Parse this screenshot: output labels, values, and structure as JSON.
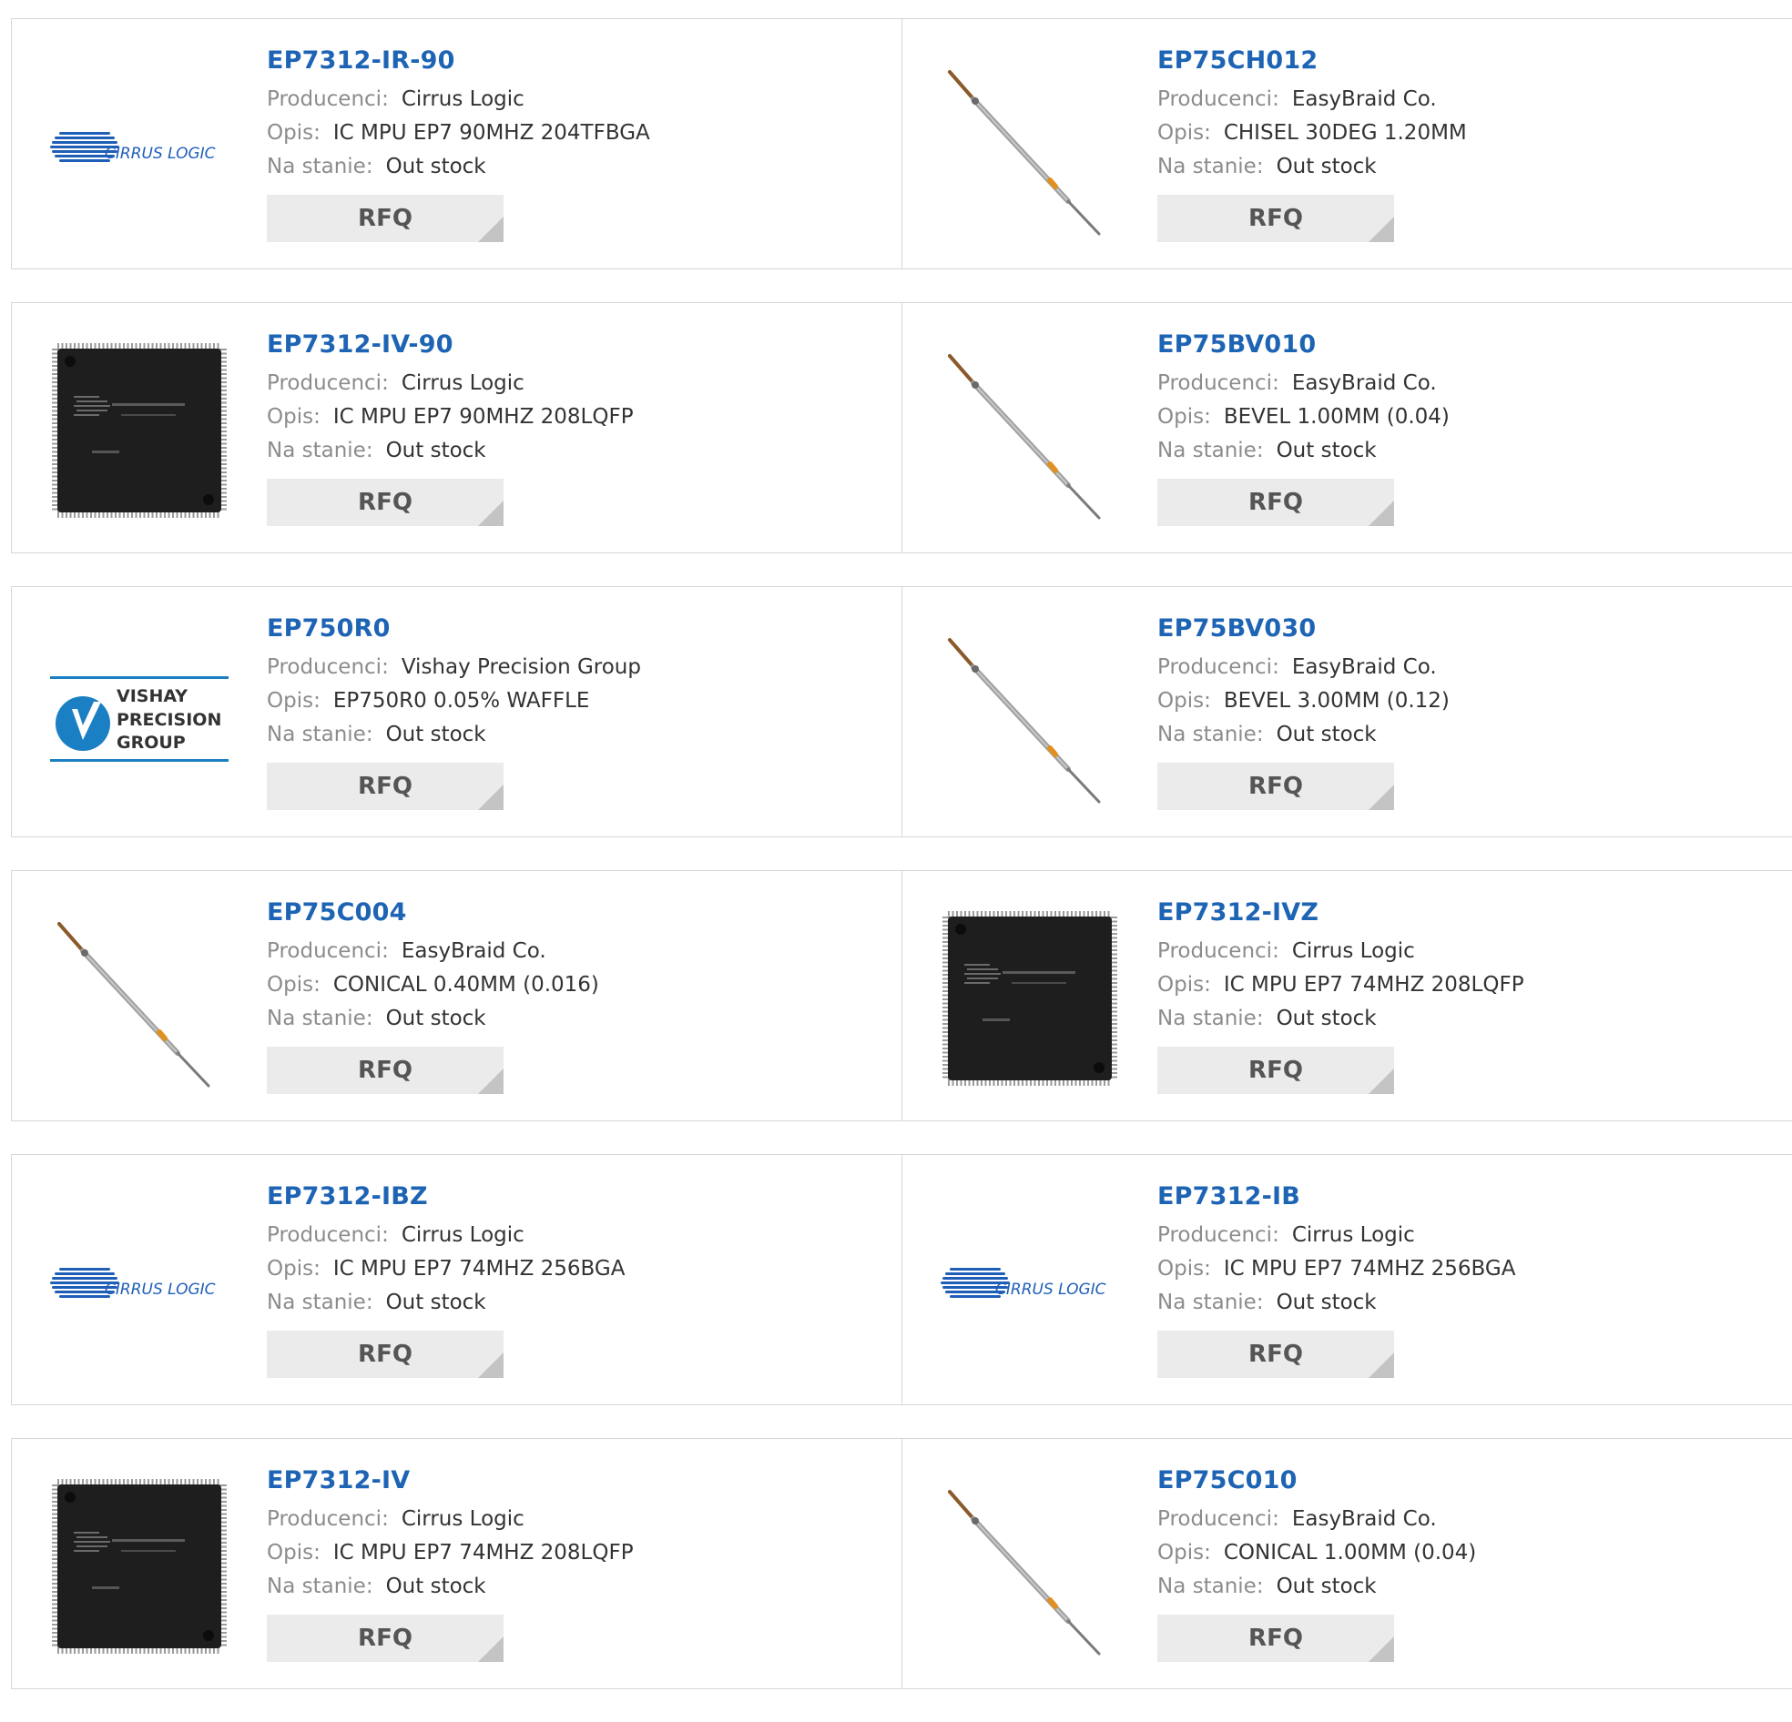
{
  "labels": {
    "manufacturer": "Producenci:",
    "description": "Opis:",
    "stock": "Na stanie:",
    "rfq": "RFQ"
  },
  "colors": {
    "part_link": "#1e64b4",
    "label_gray": "#8c8c8c",
    "button_bg": "#ebebeb",
    "button_corner": "#c4c4c4",
    "card_border": "#d6d6d6",
    "cirrus_blue": "#1f5fb8",
    "vishay_blue": "#1b7fc4"
  },
  "products": [
    {
      "part": "EP7312-IR-90",
      "manufacturer": "Cirrus Logic",
      "description": "IC MPU EP7 90MHZ 204TFBGA",
      "stock": "Out stock",
      "image": "cirrus-logo",
      "image_text": "CIRRUS LOGIC"
    },
    {
      "part": "EP75CH012",
      "manufacturer": "EasyBraid Co.",
      "description": "CHISEL 30DEG 1.20MM",
      "stock": "Out stock",
      "image": "solder-tip"
    },
    {
      "part": "EP7312-IV-90",
      "manufacturer": "Cirrus Logic",
      "description": "IC MPU EP7 90MHZ 208LQFP",
      "stock": "Out stock",
      "image": "chip"
    },
    {
      "part": "EP75BV010",
      "manufacturer": "EasyBraid Co.",
      "description": "BEVEL 1.00MM (0.04)",
      "stock": "Out stock",
      "image": "solder-tip"
    },
    {
      "part": "EP750R0",
      "manufacturer": "Vishay Precision Group",
      "description": "EP750R0 0.05% WAFFLE",
      "stock": "Out stock",
      "image": "vishay-logo",
      "image_text": [
        "VISHAY",
        "PRECISION",
        "GROUP"
      ]
    },
    {
      "part": "EP75BV030",
      "manufacturer": "EasyBraid Co.",
      "description": "BEVEL 3.00MM (0.12)",
      "stock": "Out stock",
      "image": "solder-tip"
    },
    {
      "part": "EP75C004",
      "manufacturer": "EasyBraid Co.",
      "description": "CONICAL 0.40MM (0.016)",
      "stock": "Out stock",
      "image": "solder-tip"
    },
    {
      "part": "EP7312-IVZ",
      "manufacturer": "Cirrus Logic",
      "description": "IC MPU EP7 74MHZ 208LQFP",
      "stock": "Out stock",
      "image": "chip"
    },
    {
      "part": "EP7312-IBZ",
      "manufacturer": "Cirrus Logic",
      "description": "IC MPU EP7 74MHZ 256BGA",
      "stock": "Out stock",
      "image": "cirrus-logo",
      "image_text": "CIRRUS LOGIC"
    },
    {
      "part": "EP7312-IB",
      "manufacturer": "Cirrus Logic",
      "description": "IC MPU EP7 74MHZ 256BGA",
      "stock": "Out stock",
      "image": "cirrus-logo",
      "image_text": "CIRRUS LOGIC"
    },
    {
      "part": "EP7312-IV",
      "manufacturer": "Cirrus Logic",
      "description": "IC MPU EP7 74MHZ 208LQFP",
      "stock": "Out stock",
      "image": "chip"
    },
    {
      "part": "EP75C010",
      "manufacturer": "EasyBraid Co.",
      "description": "CONICAL 1.00MM (0.04)",
      "stock": "Out stock",
      "image": "solder-tip"
    }
  ]
}
